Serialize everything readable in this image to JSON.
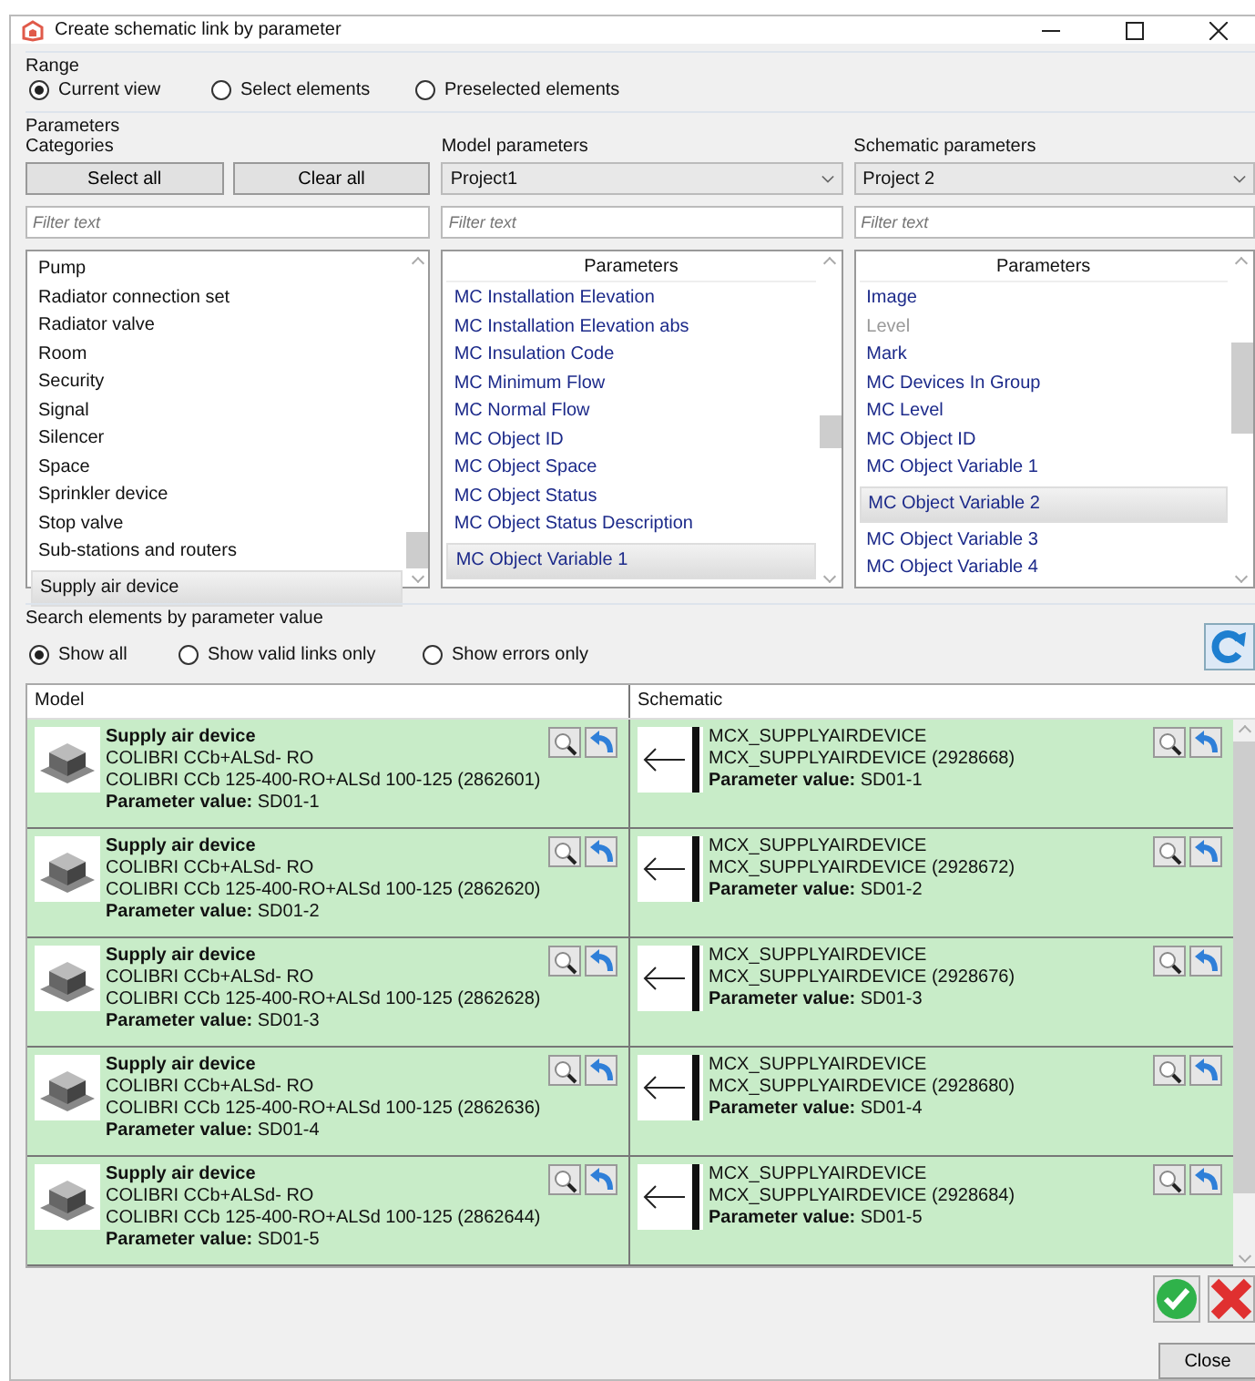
{
  "window": {
    "title": "Create schematic link by parameter"
  },
  "range": {
    "label": "Range",
    "options": [
      {
        "label": "Current view",
        "selected": true
      },
      {
        "label": "Select elements",
        "selected": false
      },
      {
        "label": "Preselected elements",
        "selected": false
      }
    ]
  },
  "parameters": {
    "label": "Parameters",
    "categories": {
      "label": "Categories",
      "buttons": [
        "Select all",
        "Clear all"
      ],
      "filter": {
        "placeholder": "Filter text"
      },
      "items": [
        {
          "label": "Pump",
          "selected": false
        },
        {
          "label": "Radiator connection set",
          "selected": false
        },
        {
          "label": "Radiator valve",
          "selected": false
        },
        {
          "label": "Room",
          "selected": false
        },
        {
          "label": "Security",
          "selected": false
        },
        {
          "label": "Signal",
          "selected": false
        },
        {
          "label": "Silencer",
          "selected": false
        },
        {
          "label": "Space",
          "selected": false
        },
        {
          "label": "Sprinkler device",
          "selected": false
        },
        {
          "label": "Stop valve",
          "selected": false
        },
        {
          "label": "Sub-stations and routers",
          "selected": false
        },
        {
          "label": "Supply air device",
          "selected": true
        }
      ]
    },
    "model": {
      "label": "Model parameters",
      "project": "Project1",
      "filter": {
        "placeholder": "Filter text"
      },
      "header": "Parameters",
      "items": [
        {
          "label": "MC Installation Elevation",
          "selected": false,
          "disabled": false
        },
        {
          "label": "MC Installation Elevation abs",
          "selected": false,
          "disabled": false
        },
        {
          "label": "MC Insulation Code",
          "selected": false,
          "disabled": false
        },
        {
          "label": "MC Minimum Flow",
          "selected": false,
          "disabled": false
        },
        {
          "label": "MC Normal Flow",
          "selected": false,
          "disabled": false
        },
        {
          "label": "MC Object ID",
          "selected": false,
          "disabled": false
        },
        {
          "label": "MC Object Space",
          "selected": false,
          "disabled": false
        },
        {
          "label": "MC Object Status",
          "selected": false,
          "disabled": false
        },
        {
          "label": "MC Object Status Description",
          "selected": false,
          "disabled": false
        },
        {
          "label": "MC Object Variable 1",
          "selected": true,
          "disabled": false
        }
      ]
    },
    "schematic": {
      "label": "Schematic parameters",
      "project": "Project 2",
      "filter": {
        "placeholder": "Filter text"
      },
      "header": "Parameters",
      "items": [
        {
          "label": "Image",
          "selected": false,
          "disabled": false
        },
        {
          "label": "Level",
          "selected": false,
          "disabled": true
        },
        {
          "label": "Mark",
          "selected": false,
          "disabled": false
        },
        {
          "label": "MC Devices In Group",
          "selected": false,
          "disabled": false
        },
        {
          "label": "MC Level",
          "selected": false,
          "disabled": false
        },
        {
          "label": "MC Object ID",
          "selected": false,
          "disabled": false
        },
        {
          "label": "MC Object Variable 1",
          "selected": false,
          "disabled": false
        },
        {
          "label": "MC Object Variable 2",
          "selected": true,
          "disabled": false
        },
        {
          "label": "MC Object Variable 3",
          "selected": false,
          "disabled": false
        },
        {
          "label": "MC Object Variable 4",
          "selected": false,
          "disabled": false
        }
      ]
    }
  },
  "search": {
    "label": "Search elements by parameter value",
    "options": [
      {
        "label": "Show all",
        "selected": true
      },
      {
        "label": "Show valid links only",
        "selected": false
      },
      {
        "label": "Show errors only",
        "selected": false
      }
    ]
  },
  "results": {
    "columns": [
      "Model",
      "Schematic"
    ],
    "rows": [
      {
        "model": {
          "title": "Supply air device",
          "type": "COLIBRI CCb+ALSd- RO",
          "detail": "COLIBRI CCb 125-400-RO+ALSd 100-125 (2862601)",
          "value_label": "Parameter value:",
          "value": "SD01-1"
        },
        "schematic": {
          "title": "MCX_SUPPLYAIRDEVICE",
          "detail": "MCX_SUPPLYAIRDEVICE (2928668)",
          "value_label": "Parameter value:",
          "value": "SD01-1"
        }
      },
      {
        "model": {
          "title": "Supply air device",
          "type": "COLIBRI CCb+ALSd- RO",
          "detail": "COLIBRI CCb 125-400-RO+ALSd 100-125 (2862620)",
          "value_label": "Parameter value:",
          "value": "SD01-2"
        },
        "schematic": {
          "title": "MCX_SUPPLYAIRDEVICE",
          "detail": "MCX_SUPPLYAIRDEVICE (2928672)",
          "value_label": "Parameter value:",
          "value": "SD01-2"
        }
      },
      {
        "model": {
          "title": "Supply air device",
          "type": "COLIBRI CCb+ALSd- RO",
          "detail": "COLIBRI CCb 125-400-RO+ALSd 100-125 (2862628)",
          "value_label": "Parameter value:",
          "value": "SD01-3"
        },
        "schematic": {
          "title": "MCX_SUPPLYAIRDEVICE",
          "detail": "MCX_SUPPLYAIRDEVICE (2928676)",
          "value_label": "Parameter value:",
          "value": "SD01-3"
        }
      },
      {
        "model": {
          "title": "Supply air device",
          "type": "COLIBRI CCb+ALSd- RO",
          "detail": "COLIBRI CCb 125-400-RO+ALSd 100-125 (2862636)",
          "value_label": "Parameter value:",
          "value": "SD01-4"
        },
        "schematic": {
          "title": "MCX_SUPPLYAIRDEVICE",
          "detail": "MCX_SUPPLYAIRDEVICE (2928680)",
          "value_label": "Parameter value:",
          "value": "SD01-4"
        }
      },
      {
        "model": {
          "title": "Supply air device",
          "type": "COLIBRI CCb+ALSd- RO",
          "detail": "COLIBRI CCb 125-400-RO+ALSd 100-125 (2862644)",
          "value_label": "Parameter value:",
          "value": "SD01-5"
        },
        "schematic": {
          "title": "MCX_SUPPLYAIRDEVICE",
          "detail": "MCX_SUPPLYAIRDEVICE (2928684)",
          "value_label": "Parameter value:",
          "value": "SD01-5"
        }
      }
    ]
  },
  "buttons": {
    "close": "Close"
  }
}
